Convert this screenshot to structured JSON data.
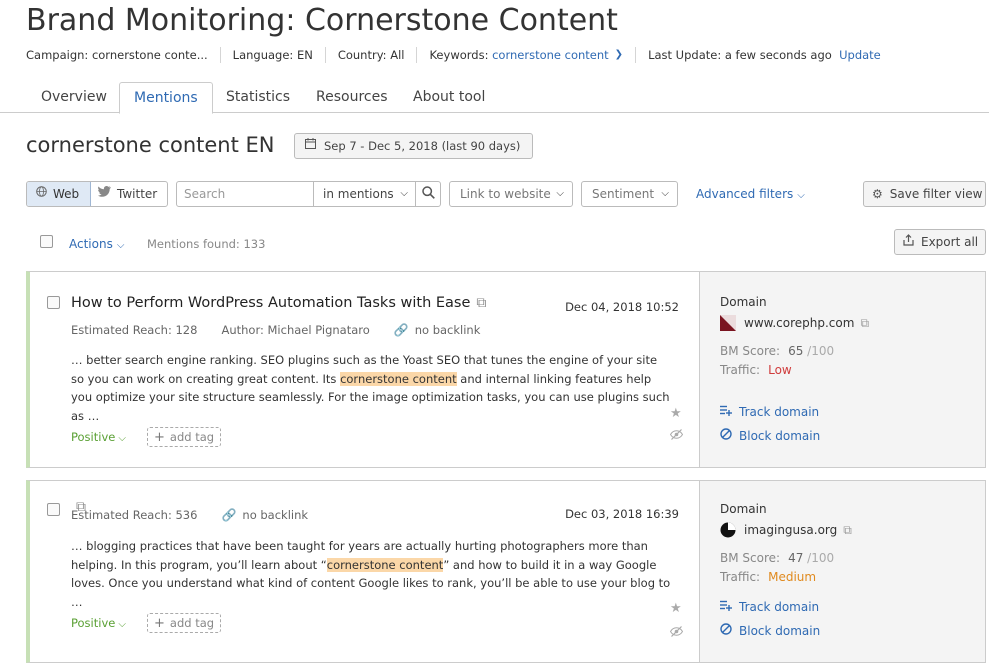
{
  "header": {
    "title": "Brand Monitoring: Cornerstone Content",
    "campaign": "Campaign: cornerstone conte...",
    "language": "Language: EN",
    "country": "Country: All",
    "keywords_label": "Keywords:",
    "keywords_value": "cornerstone content",
    "last_update": "Last Update: a few seconds ago",
    "update_link": "Update"
  },
  "tabs": [
    {
      "label": "Overview"
    },
    {
      "label": "Mentions"
    },
    {
      "label": "Statistics"
    },
    {
      "label": "Resources"
    },
    {
      "label": "About tool"
    }
  ],
  "active_tab": "Mentions",
  "page": {
    "heading": "cornerstone content EN",
    "date_range": "Sep 7 - Dec 5, 2018 (last 90 days)"
  },
  "filters": {
    "web": "Web",
    "twitter": "Twitter",
    "search_placeholder": "Search",
    "search_scope": "in mentions",
    "link_to_website": "Link to website",
    "sentiment": "Sentiment",
    "advanced": "Advanced filters",
    "save_view": "Save filter view"
  },
  "toolbar": {
    "actions": "Actions",
    "mentions_found": "Mentions found: 133",
    "export": "Export all"
  },
  "mentions": [
    {
      "title": "How to Perform WordPress Automation Tasks with Ease",
      "date": "Dec 04, 2018 10:52",
      "reach": "Estimated Reach: 128",
      "author": "Author: Michael Pignataro",
      "backlink": "no backlink",
      "snippet_before": "… better search engine ranking. SEO plugins such as the Yoast SEO that tunes the engine of your site so you can work on creating great content. Its ",
      "snippet_highlight": "cornerstone content",
      "snippet_after": " and internal linking features help you optimize your site structure seamlessly. For the image optimization tasks, you can use plugins such as …",
      "sentiment": "Positive",
      "add_tag": "add tag",
      "domain_label": "Domain",
      "domain": "www.corephp.com",
      "bm_label": "BM Score:",
      "bm_score": "65",
      "bm_max": "/100",
      "traffic_label": "Traffic:",
      "traffic": "Low",
      "track": "Track domain",
      "block": "Block domain"
    },
    {
      "title": "",
      "date": "Dec 03, 2018 16:39",
      "reach": "Estimated Reach: 536",
      "author": "",
      "backlink": "no backlink",
      "snippet_before": "… blogging practices that have been taught for years are actually hurting photographers more than helping. In this program, you’ll learn about “",
      "snippet_highlight": "cornerstone content",
      "snippet_after": "” and how to build it in a way Google loves. Once you understand what kind of content Google likes to rank, you’ll be able to use your blog to …",
      "sentiment": "Positive",
      "add_tag": "add tag",
      "domain_label": "Domain",
      "domain": "imagingusa.org",
      "bm_label": "BM Score:",
      "bm_score": "47",
      "bm_max": "/100",
      "traffic_label": "Traffic:",
      "traffic": "Medium",
      "track": "Track domain",
      "block": "Block domain"
    }
  ],
  "colors": {
    "accent": "#2f6ab3",
    "positive": "#5aa034",
    "traffic_low": "#d03c3c",
    "traffic_medium": "#e08a1e",
    "highlight": "#fbd7a8"
  }
}
